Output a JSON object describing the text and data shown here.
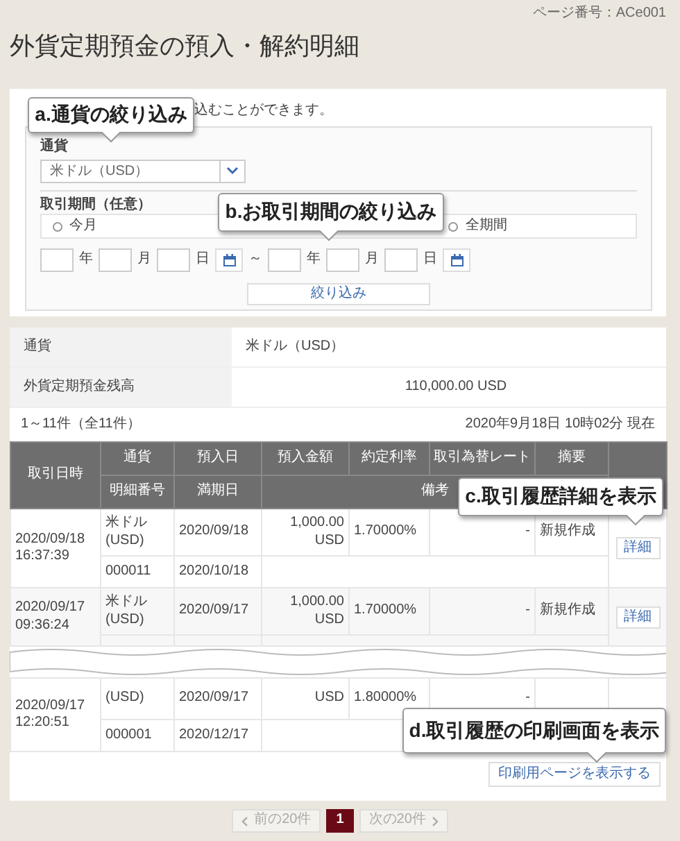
{
  "page_number": "ページ番号：ACe001",
  "title": "外貨定期預金の預入・解約明細",
  "filter": {
    "intro": "込むことができます。",
    "currency_label": "通貨",
    "currency_value": "米ドル（USD）",
    "period_label": "取引期間（任意）",
    "period_options": [
      {
        "label": "今月",
        "selected": false
      },
      {
        "label": "全期間",
        "selected": false
      }
    ],
    "date_units": [
      "年",
      "月",
      "日",
      "年",
      "月",
      "日"
    ],
    "range_separator": "～",
    "button": "絞り込み"
  },
  "summary": [
    {
      "label": "通貨",
      "value": "米ドル（USD）",
      "kind": "text"
    },
    {
      "label": "外貨定期預金残高",
      "value": "110,000.00 USD",
      "kind": "amount"
    }
  ],
  "count": "1～11件（全11件）",
  "as_of": "2020年9月18日 10時02分 現在",
  "table": {
    "header_top": [
      "取引日時",
      "通貨",
      "預入日",
      "預入金額",
      "約定利率",
      "取引為替レート",
      "摘要"
    ],
    "header_bottom": [
      "明細番号",
      "満期日",
      "備考"
    ],
    "rows": [
      {
        "kind": "full",
        "date": "2020/09/18",
        "time": "16:37:39",
        "currency": "米ドル (USD)",
        "deposit_date": "2020/09/18",
        "amount": "1,000.00 USD",
        "rate": "1.70000%",
        "fx_rate": "-",
        "summary": "新規作成",
        "detail_button": "詳細",
        "number": "000011",
        "maturity": "2020/10/18"
      },
      {
        "kind": "cut_below",
        "date": "2020/09/17",
        "time": "09:36:24",
        "currency": "米ドル (USD)",
        "deposit_date": "2020/09/17",
        "amount": "1,000.00 USD",
        "rate": "1.70000%",
        "fx_rate": "-",
        "summary": "新規作成",
        "detail_button": "詳細"
      },
      {
        "kind": "cut_above",
        "date": "2020/09/17",
        "time": "12:20:51",
        "currency": "(USD)",
        "deposit_date": "2020/09/17",
        "amount": "USD",
        "rate": "1.80000%",
        "fx_rate": "-",
        "number": "000001",
        "maturity": "2020/12/17"
      }
    ]
  },
  "print_button": "印刷用ページを表示する",
  "pagination": {
    "prev": "前の20件",
    "prev_disabled": true,
    "pages": [
      {
        "label": "1",
        "selected": true
      }
    ],
    "next": "次の20件",
    "next_disabled": true
  },
  "callouts": [
    {
      "text": "a.通貨の絞り込み"
    },
    {
      "text": "b.お取引期間の絞り込み"
    },
    {
      "text": "c.取引履歴詳細を表示"
    },
    {
      "text": "d.取引履歴の印刷画面を表示"
    }
  ]
}
